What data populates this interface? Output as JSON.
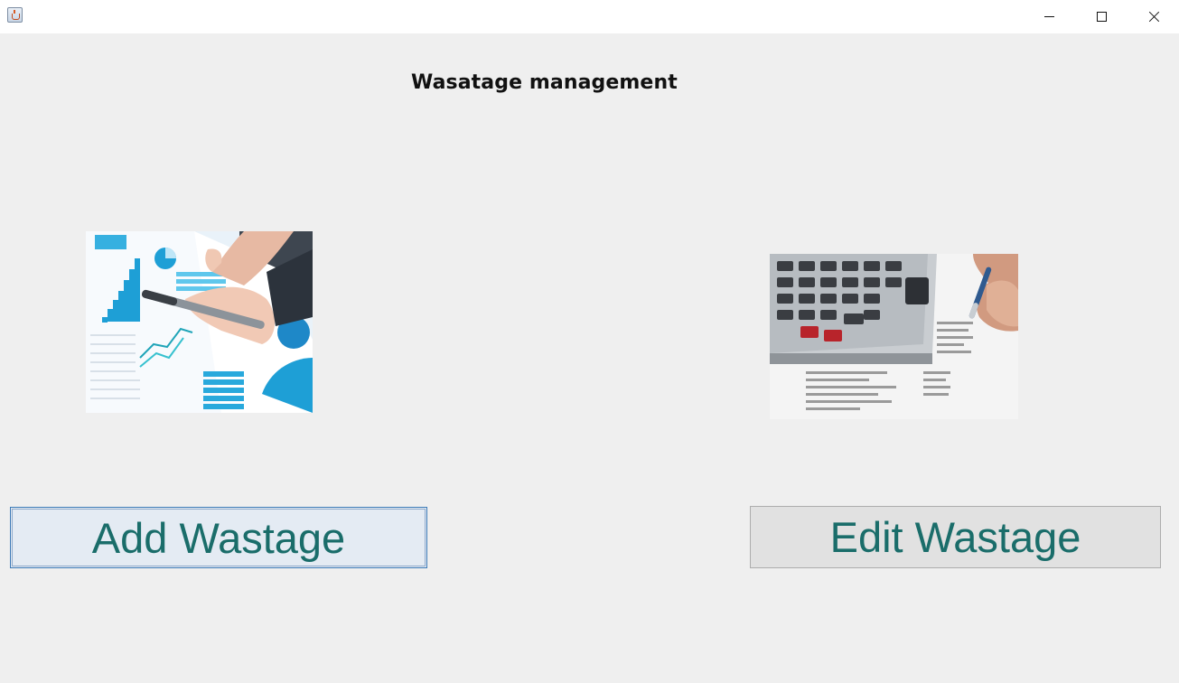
{
  "window": {
    "title": "",
    "icon": "java-cup-icon",
    "controls": [
      "minimize",
      "maximize",
      "close"
    ]
  },
  "main": {
    "heading": "Wasatage management",
    "add_image": {
      "depicts": "hand-with-pen-over-charts-photo"
    },
    "edit_image": {
      "depicts": "hand-with-pen-and-calculator-photo"
    },
    "add_button_label": "Add Wastage",
    "edit_button_label": "Edit Wastage"
  },
  "colors": {
    "button_text": "#1a6d6a",
    "background": "#efefef",
    "focus_border": "#3d7ab7"
  }
}
